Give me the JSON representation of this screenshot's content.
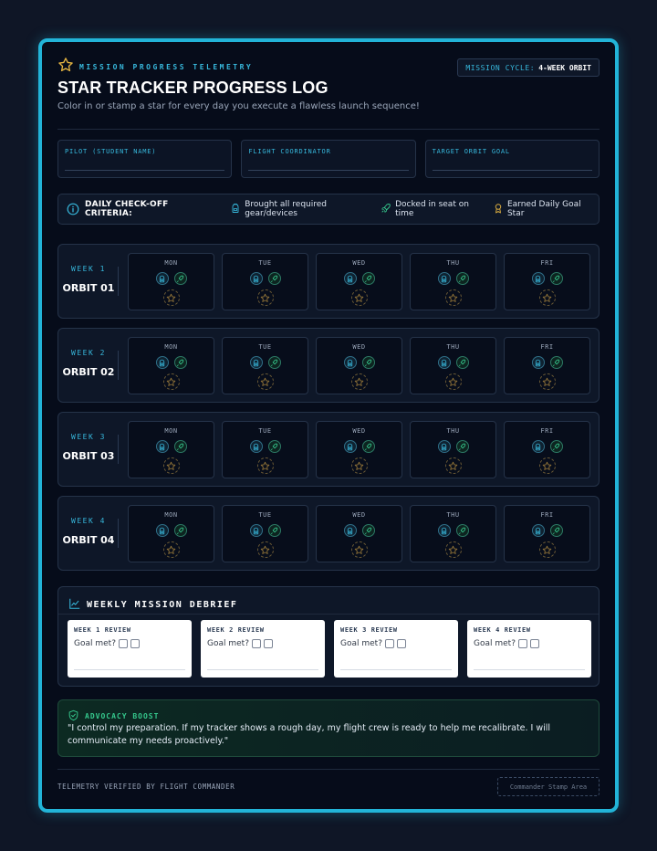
{
  "header": {
    "kicker": "MISSION PROGRESS TELEMETRY",
    "title": "STAR TRACKER PROGRESS LOG",
    "description": "Color in or stamp a star for every day you execute a flawless launch sequence!",
    "cycle_label": "MISSION CYCLE:",
    "cycle_value": "4-WEEK ORBIT",
    "icon": "star-outline-icon"
  },
  "fields": [
    {
      "label": "PILOT (STUDENT NAME)"
    },
    {
      "label": "FLIGHT COORDINATOR"
    },
    {
      "label": "TARGET ORBIT GOAL"
    }
  ],
  "criteria": {
    "label": "DAILY CHECK-OFF CRITERIA:",
    "items": [
      {
        "icon": "backpack-icon",
        "text": "Brought all required gear/devices"
      },
      {
        "icon": "rocket-icon",
        "text": "Docked in seat on time"
      },
      {
        "icon": "award-icon",
        "text": "Earned Daily Goal Star"
      }
    ]
  },
  "days": [
    "MON",
    "TUE",
    "WED",
    "THU",
    "FRI"
  ],
  "weeks": [
    {
      "num": "WEEK 1",
      "name": "ORBIT 01"
    },
    {
      "num": "WEEK 2",
      "name": "ORBIT 02"
    },
    {
      "num": "WEEK 3",
      "name": "ORBIT 03"
    },
    {
      "num": "WEEK 4",
      "name": "ORBIT 04"
    }
  ],
  "debrief": {
    "title": "WEEKLY MISSION DEBRIEF",
    "goal_label": "Goal met?",
    "reviews": [
      "WEEK 1 REVIEW",
      "WEEK 2 REVIEW",
      "WEEK 3 REVIEW",
      "WEEK 4 REVIEW"
    ]
  },
  "advocacy": {
    "title": "ADVOCACY BOOST",
    "quote": "\"I control my preparation. If my tracker shows a rough day, my flight crew is ready to help me recalibrate. I will communicate my needs proactively.\""
  },
  "footer": {
    "verified": "TELEMETRY VERIFIED BY FLIGHT COMMANDER",
    "stamp": "Commander Stamp Area"
  },
  "colors": {
    "accent_cyan": "#22b4d8",
    "accent_green": "#35c98d",
    "accent_gold": "#e3b341",
    "background": "#060c1a"
  }
}
